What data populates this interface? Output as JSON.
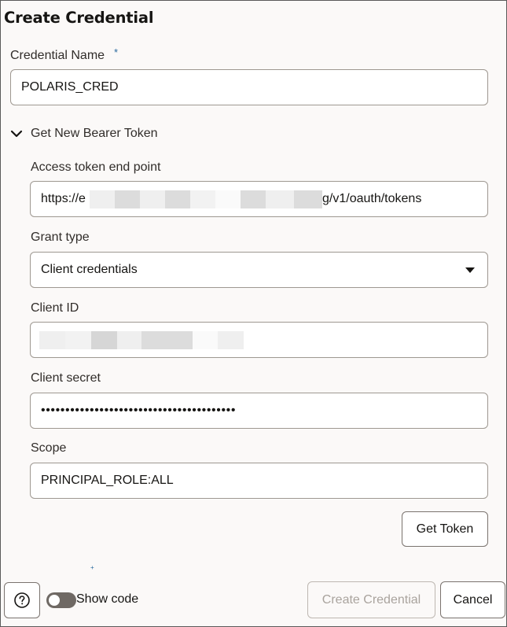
{
  "dialog": {
    "title": "Create Credential"
  },
  "credential_name": {
    "label": "Credential Name",
    "required_marker": "*",
    "value": "POLARIS_CRED"
  },
  "bearer_token_section": {
    "label": "Get New Bearer Token",
    "expanded": true,
    "access_token_endpoint": {
      "label": "Access token end point",
      "value_prefix": "https://e",
      "value_suffix": "g/v1/oauth/tokens",
      "redacted": true
    },
    "grant_type": {
      "label": "Grant type",
      "value": "Client credentials"
    },
    "client_id": {
      "label": "Client ID",
      "redacted": true
    },
    "client_secret": {
      "label": "Client secret",
      "value": "••••••••••••••••••••••••••••••••••••••••"
    },
    "scope": {
      "label": "Scope",
      "value": "PRINCIPAL_ROLE:ALL"
    },
    "get_token_button": "Get Token"
  },
  "footer": {
    "help_icon": "question-circle-icon",
    "show_code_label": "Show code",
    "show_code_on": false,
    "create_button": "Create Credential",
    "cancel_button": "Cancel"
  },
  "colors": {
    "accent": "#2b6a9e",
    "background": "#fbf9f8",
    "border": "#9e9891",
    "disabled_text": "#a9a39d"
  }
}
